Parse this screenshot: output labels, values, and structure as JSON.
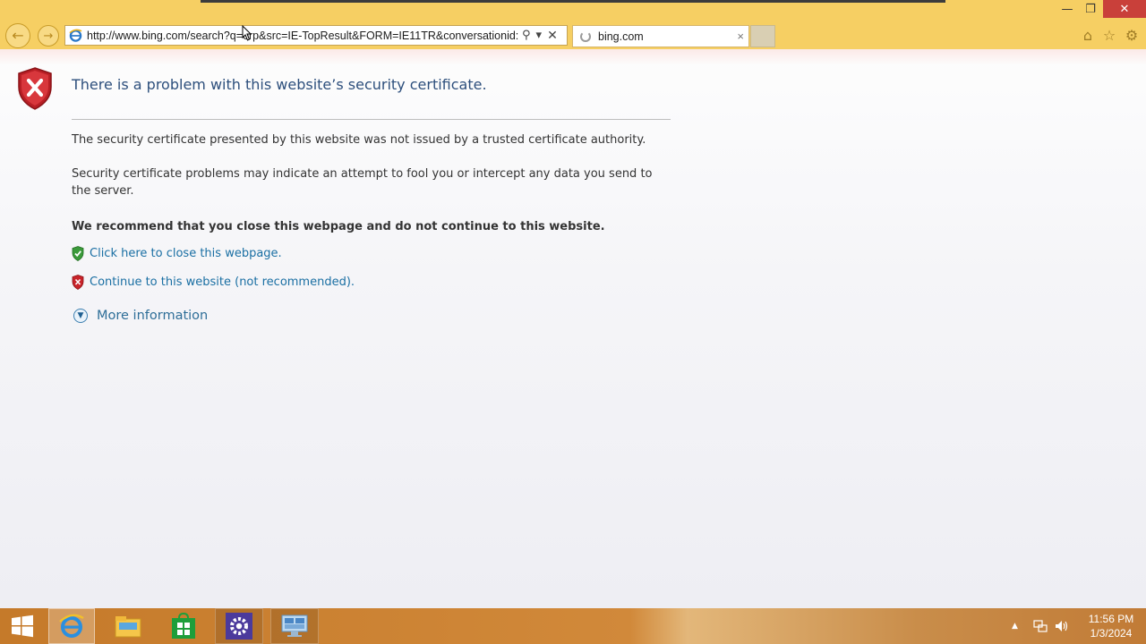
{
  "browser": {
    "address_url": "http://www.bing.com/search?q=",
    "address_url_rest": "orp&src=IE-TopResult&FORM=IE11TR&conversationid:",
    "tab_title": "bing.com",
    "tab_close_glyph": "×",
    "nav_back_glyph": "←",
    "nav_forward_glyph": "→",
    "addr_search_glyph": "⚲",
    "addr_dropdown_glyph": "▾",
    "addr_close_glyph": "✕",
    "window": {
      "minimize": "—",
      "maximize": "❐",
      "close": "✕"
    },
    "tools": {
      "home": "⌂",
      "favorites": "☆",
      "settings": "⚙"
    }
  },
  "page": {
    "title": "There is a problem with this website’s security certificate.",
    "paragraph_1": "The security certificate presented by this website was not issued by a trusted certificate authority.",
    "paragraph_2": "Security certificate problems may indicate an attempt to fool you or intercept any data you send to the server.",
    "recommendation": "We recommend that you close this webpage and do not continue to this website.",
    "close_link": "Click here to close this webpage.",
    "continue_link": "Continue to this website (not recommended).",
    "more_info": "More information"
  },
  "taskbar": {
    "clock_time": "11:56 PM",
    "clock_date": "1/3/2024",
    "tray_arrow_glyph": "▲"
  },
  "colors": {
    "chrome": "#f6cf63",
    "title_blue": "#2d4f7c",
    "link_blue": "#1a6fa3",
    "shield_red": "#c8232a",
    "shield_green": "#3a9a3a",
    "taskbar_orange": "#c57a2a"
  }
}
